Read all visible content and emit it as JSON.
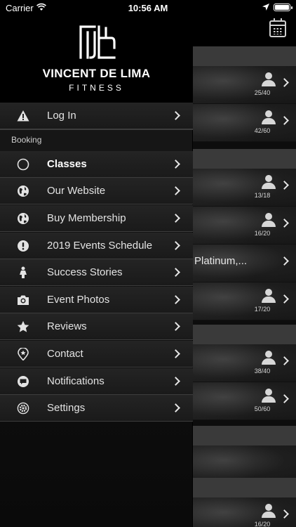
{
  "status_bar": {
    "carrier": "Carrier",
    "time": "10:56 AM"
  },
  "brand": {
    "name": "VINCENT DE LIMA",
    "subtitle": "FITNESS"
  },
  "menu": {
    "login": "Log In",
    "section_booking": "Booking",
    "items": [
      {
        "label": "Classes",
        "icon": "circle-icon"
      },
      {
        "label": "Our Website",
        "icon": "globe-icon"
      },
      {
        "label": "Buy Membership",
        "icon": "globe-icon"
      },
      {
        "label": "2019 Events Schedule",
        "icon": "exclamation-icon"
      },
      {
        "label": "Success Stories",
        "icon": "person-icon"
      },
      {
        "label": "Event Photos",
        "icon": "camera-icon"
      },
      {
        "label": "Reviews",
        "icon": "star-icon"
      },
      {
        "label": "Contact",
        "icon": "pin-icon"
      },
      {
        "label": "Notifications",
        "icon": "chat-bubble-icon"
      },
      {
        "label": "Settings",
        "icon": "gear-icon"
      }
    ]
  },
  "schedule": {
    "rows": [
      {
        "count": "25/40",
        "name": ""
      },
      {
        "count": "42/60",
        "name": ""
      },
      {
        "count": "13/18",
        "name": ""
      },
      {
        "count": "16/20",
        "name": ""
      },
      {
        "count": "",
        "name": "Platinum,..."
      },
      {
        "count": "17/20",
        "name": ""
      },
      {
        "count": "38/40",
        "name": ""
      },
      {
        "count": "50/60",
        "name": ""
      },
      {
        "count": "16/20",
        "name": ""
      }
    ]
  },
  "colors": {
    "drawer_bg": "#1a1a1a",
    "header_bg": "#000000",
    "divider": "#3d3d3d",
    "section_header": "#3a3a3a"
  }
}
